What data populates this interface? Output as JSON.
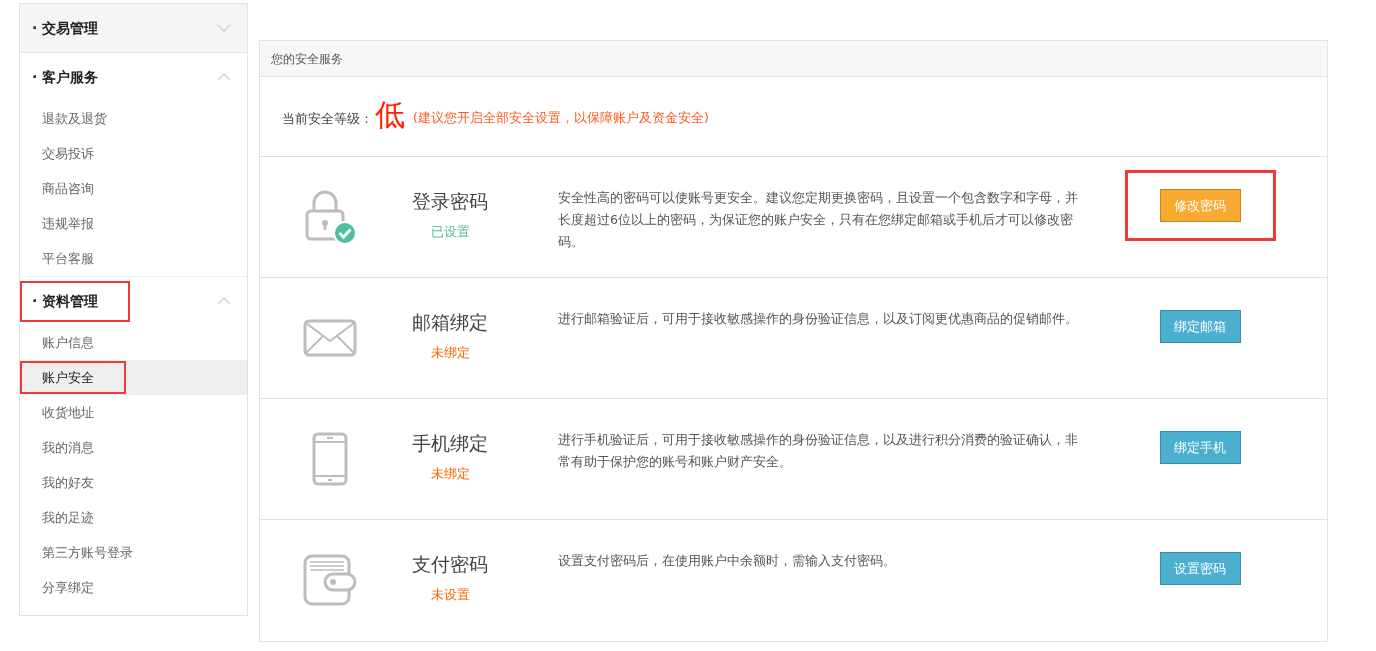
{
  "sidebar": {
    "groups": [
      {
        "label": "· 交易管理",
        "expanded": false,
        "highlighted": false
      },
      {
        "label": "· 客户服务",
        "expanded": true,
        "highlighted": false,
        "items": [
          {
            "label": "退款及退货",
            "selected": false,
            "highlighted": false
          },
          {
            "label": "交易投诉",
            "selected": false,
            "highlighted": false
          },
          {
            "label": "商品咨询",
            "selected": false,
            "highlighted": false
          },
          {
            "label": "违规举报",
            "selected": false,
            "highlighted": false
          },
          {
            "label": "平台客服",
            "selected": false,
            "highlighted": false
          }
        ]
      },
      {
        "label": "· 资料管理",
        "expanded": true,
        "highlighted": true,
        "items": [
          {
            "label": "账户信息",
            "selected": false,
            "highlighted": false
          },
          {
            "label": "账户安全",
            "selected": true,
            "highlighted": true
          },
          {
            "label": "收货地址",
            "selected": false,
            "highlighted": false
          },
          {
            "label": "我的消息",
            "selected": false,
            "highlighted": false
          },
          {
            "label": "我的好友",
            "selected": false,
            "highlighted": false
          },
          {
            "label": "我的足迹",
            "selected": false,
            "highlighted": false
          },
          {
            "label": "第三方账号登录",
            "selected": false,
            "highlighted": false
          },
          {
            "label": "分享绑定",
            "selected": false,
            "highlighted": false
          }
        ]
      }
    ]
  },
  "panel": {
    "title": "您的安全服务",
    "level_label": "当前安全等级：",
    "level_value": "低",
    "level_note": "(建议您开启全部安全设置，以保障账户及资金安全)",
    "services": [
      {
        "kind": "lock",
        "title": "登录密码",
        "status": "已设置",
        "set": true,
        "description": "安全性高的密码可以使账号更安全。建议您定期更换密码，且设置一个包含数字和字母，并长度超过6位以上的密码，为保证您的账户安全，只有在您绑定邮箱或手机后才可以修改密码。",
        "button": {
          "label": "修改密码",
          "color": "#f9a830"
        },
        "highlighted": true
      },
      {
        "kind": "mail",
        "title": "邮箱绑定",
        "status": "未绑定",
        "set": false,
        "description": "进行邮箱验证后，可用于接收敏感操作的身份验证信息，以及订阅更优惠商品的促销邮件。",
        "button": {
          "label": "绑定邮箱",
          "color": "#4bafcf"
        },
        "highlighted": false
      },
      {
        "kind": "phone",
        "title": "手机绑定",
        "status": "未绑定",
        "set": false,
        "description": "进行手机验证后，可用于接收敏感操作的身份验证信息，以及进行积分消费的验证确认，非常有助于保护您的账号和账户财产安全。",
        "button": {
          "label": "绑定手机",
          "color": "#4bafcf"
        },
        "highlighted": false
      },
      {
        "kind": "wallet",
        "title": "支付密码",
        "status": "未设置",
        "set": false,
        "description": "设置支付密码后，在使用账户中余额时，需输入支付密码。",
        "button": {
          "label": "设置密码",
          "color": "#4bafcf"
        },
        "highlighted": false
      }
    ]
  }
}
